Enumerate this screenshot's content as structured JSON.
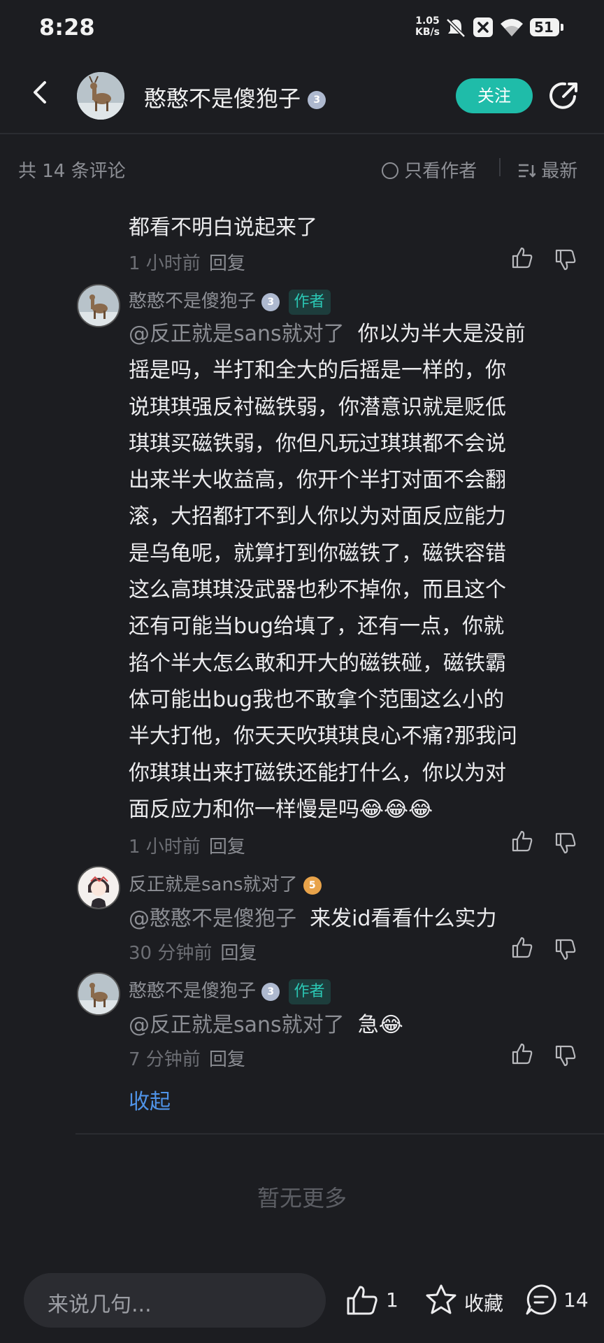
{
  "status": {
    "time": "8:28",
    "netspeed_value": "1.05",
    "netspeed_unit": "KB/s",
    "battery": "51"
  },
  "header": {
    "username": "憨憨不是傻狍子",
    "level": "3",
    "follow_label": "关注"
  },
  "sortbar": {
    "count": "共 14 条评论",
    "only_author": "只看作者",
    "latest": "最新"
  },
  "comments": [
    {
      "text": "都看不明白说起来了",
      "time": "1 小时前",
      "reply": "回复"
    },
    {
      "user": "憨憨不是傻狍子",
      "level": "3",
      "tag": "作者",
      "mention": "@反正就是sans就对了",
      "lines": [
        "你以为半大是没前",
        "摇是吗，半打和全大的后摇是一样的，你",
        "说琪琪强反衬磁铁弱，你潜意识就是贬低",
        "琪琪买磁铁弱，你但凡玩过琪琪都不会说",
        "出来半大收益高，你开个半打对面不会翻",
        "滚，大招都打不到人你以为对面反应能力",
        "是乌龟呢，就算打到你磁铁了，磁铁容错",
        "这么高琪琪没武器也秒不掉你，而且这个",
        "还有可能当bug给填了，还有一点，你就",
        "掐个半大怎么敢和开大的磁铁碰，磁铁霸",
        "体可能出bug我也不敢拿个范围这么小的",
        "半大打他，你天天吹琪琪良心不痛?那我问",
        "你琪琪出来打磁铁还能打什么，你以为对",
        "面反应力和你一样慢是吗"
      ],
      "emoji": "😂😂😂",
      "time": "1 小时前",
      "reply": "回复"
    },
    {
      "user": "反正就是sans就对了",
      "level": "5",
      "mention": "@憨憨不是傻狍子",
      "text": "来发id看看什么实力",
      "time": "30 分钟前",
      "reply": "回复"
    },
    {
      "user": "憨憨不是傻狍子",
      "level": "3",
      "tag": "作者",
      "mention": "@反正就是sans就对了",
      "text": "急",
      "emoji": "😂",
      "time": "7 分钟前",
      "reply": "回复"
    }
  ],
  "collapse_label": "收起",
  "no_more": "暂无更多",
  "bottom": {
    "input_placeholder": "来说几句...",
    "like_count": "1",
    "collect_label": "收藏",
    "comment_count": "14"
  },
  "colors": {
    "background": "#1c1d21",
    "accent": "#1fbca9",
    "link": "#4f93e8"
  }
}
